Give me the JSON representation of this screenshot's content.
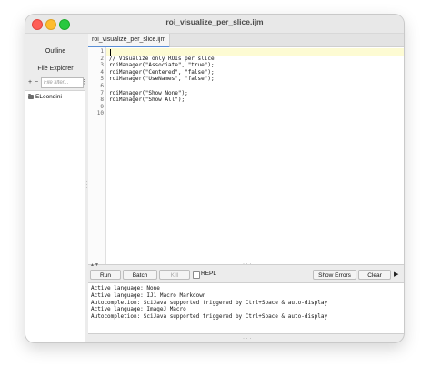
{
  "window": {
    "title": "roi_visualize_per_slice.ijm"
  },
  "sidebar": {
    "tabs": [
      "Outline",
      "File Explorer"
    ],
    "toolbar": {
      "add": "+",
      "remove": "−",
      "filter_placeholder": "File filter...",
      "menu": "⋮"
    },
    "tree": [
      {
        "label": "ELeondini",
        "icon": "folder-icon"
      }
    ]
  },
  "editor": {
    "tab_label": "roi_visualize_per_slice.ijm",
    "line_numbers": [
      "1",
      "2",
      "3",
      "4",
      "5",
      "6",
      "7",
      "8",
      "9",
      "10"
    ],
    "lines": [
      "",
      "// Visualize only ROIs per slice",
      "roiManager(\"Associate\", \"true\");",
      "roiManager(\"Centered\", \"false\");",
      "roiManager(\"UseNames\", \"false\");",
      "",
      "roiManager(\"Show None\");",
      "roiManager(\"Show All\");",
      "",
      ""
    ]
  },
  "buttons": {
    "run": "Run",
    "batch": "Batch",
    "kill": "Kill",
    "repl": "REPL",
    "show_errors": "Show Errors",
    "clear": "Clear",
    "more": "▶"
  },
  "console": {
    "lines": [
      "Active language: None",
      "Active language: IJ1 Macro Markdown",
      "Autocompletion: SciJava supported triggered by Ctrl+Space & auto-display",
      "Active language: ImageJ Macro",
      "Autocompletion: SciJava supported triggered by Ctrl+Space & auto-display"
    ]
  },
  "colors": {
    "current_line": "#fdfbd3",
    "tab_accent": "#5a8ed6"
  }
}
